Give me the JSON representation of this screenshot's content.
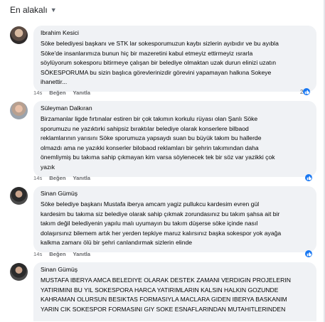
{
  "sort": {
    "label": "En alakalı"
  },
  "comments": [
    {
      "author": "Ibrahim Kesici",
      "text": "Söke belediyesi başkanı ve STK lar sokesporumuzun kaybı sizlerin ayıbıdır ve bu ayıbla\nSöke'de insanlarımıza bunun hiç bir mazeretini kabul etmeyiz ettirmeyiz ısrarla\nsöylüyorum sokesporu bitirmeye çalışan bir belediye olmaktan uzak durun elinizi uzatın\nSÖKESPORUMA bu sizin başlıca görevlerinizdir görevini yapamayan halkına Sokeye\nihanettir...",
      "time": "14s",
      "like_label": "Beğen",
      "reply_label": "Yanıtla",
      "reaction_count": "2"
    },
    {
      "author": "Süleyman Dalkıran",
      "text": "Birzamanlar ligde fırtınalar estiren bir çok takımın korkulu rüyası olan Şanlı Söke\nsporumuzu ne yazıktırki sahipsiz bıraktılar belediye olarak konserlere bilbaod\nreklamlarının yarısını Söke sporumuza yapsaydı suan bu büyük takım bu hallerde\nolmazdı ama ne yazıkki konserler bilobaod reklamları bir şehrin takımından daha\nönemliymiş bu takıma sahip çıkmayan kim varsa söylenecek tek bir söz var yazikki çok\nyazık",
      "time": "14s",
      "like_label": "Beğen",
      "reply_label": "Yanıtla"
    },
    {
      "author": "Sinan Gümüş",
      "text": "Söke belediye başkanı Mustafa iberya amcam yagiz pullukcu kardesim evren gül\nkardesim bu takıma siz belediye olarak sahip çıkmak zorundasınız bu takım şahsa ait bir\ntakım değil belediyenin yapılu malı uyumayın bu takım düşerse söke içinde nasıl\ndolaşırsınız bilemem artık her yerden tepkiye maruz kalırsınız başka sokespor yok ayağa\nkalkma zamanı ölü bir şehri canlandırmak sizlerin elinde",
      "time": "14s",
      "like_label": "Beğen",
      "reply_label": "Yanıtla"
    },
    {
      "author": "Sinan Gümüş",
      "text": "MUSTAFA IBERYA AMCA BELEDIYE OLARAK DESTEK ZAMANI VERDIGIN PROJELERIN\nYATIRIMINI BU YIL SOKESPORA HARCA YATIRIMLARIN KALSIN HALKIN GOZUNDE\nKAHRAMAN OLURSUN BESIKTAS FORMASIYLA MACLARA GIDEN IBERYA BASKANIM\nYARIN CIK SOKESPOR FORMASINI GIY SOKE ESNAFLARINDAN MUTAHITLERINDEN"
    }
  ],
  "colors": {
    "bubble": "#f0f2f5",
    "like_blue": "#1877f2",
    "meta": "#65676b"
  }
}
